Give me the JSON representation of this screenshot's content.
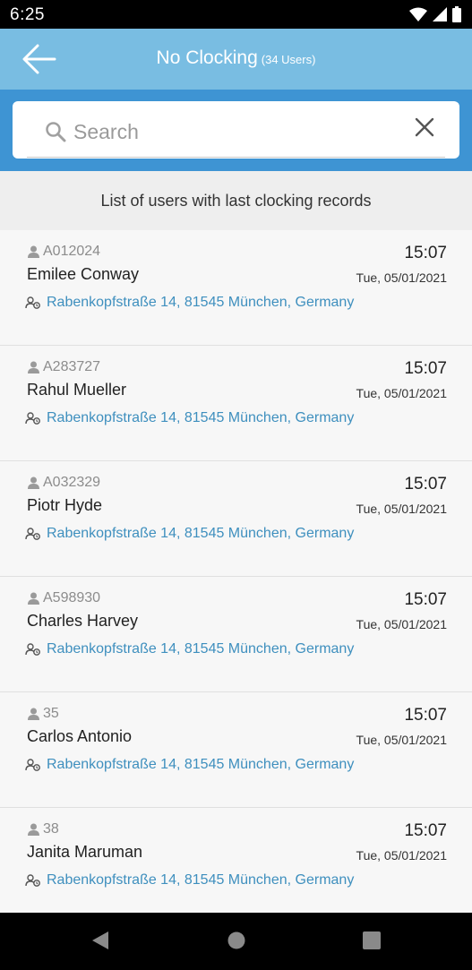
{
  "status_bar": {
    "time": "6:25"
  },
  "app_bar": {
    "title": "No Clocking",
    "subtitle": "(34 Users)"
  },
  "search": {
    "placeholder": "Search",
    "value": ""
  },
  "list_header": "List of users with last clocking records",
  "users": [
    {
      "id": "A012024",
      "name": "Emilee Conway",
      "time": "15:07",
      "date": "Tue, 05/01/2021",
      "address": "Rabenkopfstraße 14, 81545 München, Germany"
    },
    {
      "id": "A283727",
      "name": "Rahul Mueller",
      "time": "15:07",
      "date": "Tue, 05/01/2021",
      "address": "Rabenkopfstraße 14, 81545 München, Germany"
    },
    {
      "id": "A032329",
      "name": "Piotr Hyde",
      "time": "15:07",
      "date": "Tue, 05/01/2021",
      "address": "Rabenkopfstraße 14, 81545 München, Germany"
    },
    {
      "id": "A598930",
      "name": "Charles Harvey",
      "time": "15:07",
      "date": "Tue, 05/01/2021",
      "address": "Rabenkopfstraße 14, 81545 München, Germany"
    },
    {
      "id": "35",
      "name": "Carlos Antonio",
      "time": "15:07",
      "date": "Tue, 05/01/2021",
      "address": "Rabenkopfstraße 14, 81545 München, Germany"
    },
    {
      "id": "38",
      "name": "Janita Maruman",
      "time": "15:07",
      "date": "Tue, 05/01/2021",
      "address": "Rabenkopfstraße 14, 81545 München, Germany"
    }
  ],
  "icons": {
    "back": "arrow-left-icon",
    "search": "search-icon",
    "clear": "close-icon",
    "user": "person-icon",
    "address": "location-people-icon",
    "nav_back": "triangle-back-icon",
    "nav_home": "circle-home-icon",
    "nav_recents": "square-recents-icon"
  },
  "colors": {
    "app_bar": "#79bde2",
    "search_area": "#3e94d3",
    "address_text": "#3e8fbe",
    "row_background": "#f7f7f7",
    "header_background": "#eeeeee"
  }
}
